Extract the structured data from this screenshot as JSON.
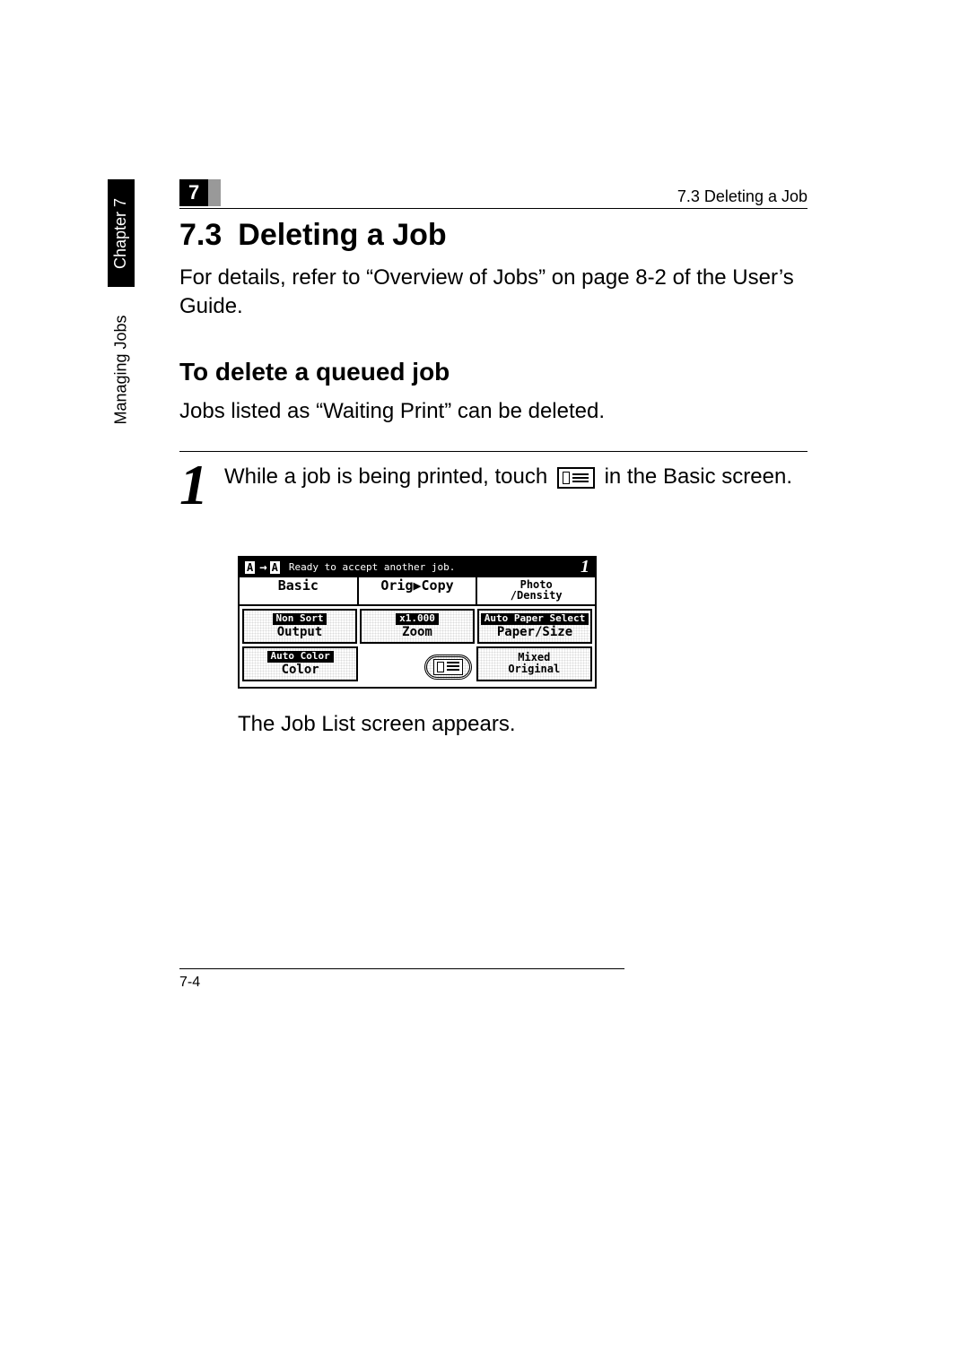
{
  "header": {
    "chapter_number": "7",
    "running_head": "7.3 Deleting a Job"
  },
  "sidebar": {
    "chapter_label": "Chapter 7",
    "section_label": "Managing Jobs"
  },
  "section": {
    "number": "7.3",
    "title": "Deleting a Job",
    "intro": "For details, refer to “Overview of Jobs” on page 8-2 of the User’s Guide.",
    "sub_heading": "To delete a queued job",
    "sub_intro": "Jobs listed as “Waiting Print” can be deleted."
  },
  "step": {
    "number": "1",
    "text_before_icon": "While a job is being printed, touch",
    "text_after_icon": "in the Basic screen.",
    "result": "The Job List screen appears."
  },
  "lcd": {
    "status": "Ready to accept another job.",
    "count": "1",
    "tabs": {
      "basic": "Basic",
      "orig_copy": "Orig▶Copy",
      "photo_density_1": "Photo",
      "photo_density_2": "/Density"
    },
    "cells": {
      "non_sort": "Non Sort",
      "output": "Output",
      "zoom_value": "x1.000",
      "zoom": "Zoom",
      "auto_paper": "Auto Paper Select",
      "paper_size": "Paper/Size",
      "auto_color": "Auto Color",
      "color": "Color",
      "mixed_1": "Mixed",
      "mixed_2": "Original"
    },
    "badge_left": "A",
    "badge_right": "A"
  },
  "footer": {
    "page": "7-4"
  }
}
